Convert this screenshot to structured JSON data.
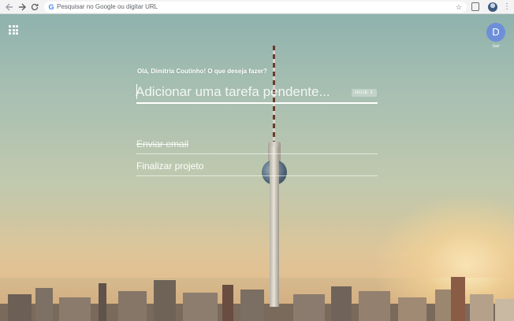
{
  "browser": {
    "back_icon": "arrow-left-icon",
    "forward_icon": "arrow-right-icon",
    "reload_icon": "reload-icon",
    "omnibox_placeholder": "Pesquisar no Google ou digitar URL",
    "google_logo": "G",
    "bookmark_icon": "star-icon",
    "menu_icon": "vertical-dots-icon"
  },
  "header": {
    "apps_icon": "grid-icon",
    "account_initial": "D",
    "signout_label": "Sair"
  },
  "main": {
    "greeting": "Olá, Dimitria Coutinho! O que deseja fazer?",
    "task_placeholder": "Adicionar uma tarefa pendente...",
    "due_label": "HOJE",
    "due_icon": "⇕"
  },
  "tasks": [
    {
      "label": "Enviar email",
      "done": true
    },
    {
      "label": "Finalizar projeto",
      "done": false
    }
  ],
  "colors": {
    "account_avatar": "#6d8fd9",
    "text": "#ffffff"
  }
}
